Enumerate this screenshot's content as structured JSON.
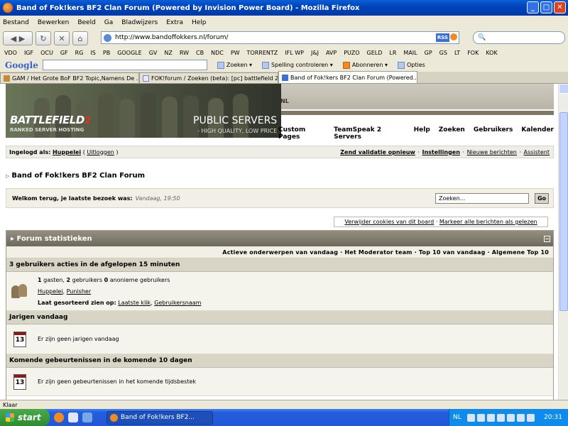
{
  "window": {
    "title": "Band of Fok!kers BF2 Clan Forum (Powered by Invision Power Board) - Mozilla Firefox",
    "min": "_",
    "max": "□",
    "close": "✕"
  },
  "menu": [
    "Bestand",
    "Bewerken",
    "Beeld",
    "Ga",
    "Bladwijzers",
    "Extra",
    "Help"
  ],
  "nav": {
    "url": "http://www.bandoffokkers.nl/forum/",
    "rss": "RSS",
    "search_placeholder": ""
  },
  "bookmarks": [
    "VDO",
    "IGF",
    "OCU",
    "GF",
    "RG",
    "IS",
    "PB",
    "GOOGLE",
    "GV",
    "NZ",
    "RW",
    "CB",
    "NDC",
    "PW",
    "TORRENTZ",
    "IFL WP",
    "J&J",
    "AVP",
    "PUZO",
    "GELD",
    "LR",
    "MAIL",
    "GP",
    "GS",
    "LT",
    "FOK",
    "KOK"
  ],
  "google_toolbar": {
    "logo": "Google",
    "search": "Zoeken",
    "spell": "Spelling controleren",
    "subscribe": "Abonneren",
    "options": "Opties"
  },
  "tabs": [
    "GAM / Het Grote BoF BF2 Topic,Namens De ...",
    "FOK!forum / Zoeken (beta): [pc] battlefield 2",
    "Band of Fok!kers BF2 Clan Forum (Powered..."
  ],
  "banner": {
    "game": "BATTLEFIELD",
    "game_num": "2",
    "ranked": "RANKED SERVER HOSTING",
    "public": "PUBLIC SERVERS",
    "quality": "- HIGH QUALITY, LOW PRICE",
    "nl": ".NL"
  },
  "topnav": [
    "Custom Pages",
    "TeamSpeak 2 Servers",
    "Help",
    "Zoeken",
    "Gebruikers",
    "Kalender"
  ],
  "userbar": {
    "prefix": "Ingelogd als:",
    "user": "Huppelei",
    "open": "(",
    "logout": "Uitloggen",
    "close": ")",
    "links": [
      "Zend validatie opnieuw",
      "Instellingen",
      "Nieuwe berichten",
      "Assistent"
    ],
    "sep": "·"
  },
  "breadcrumb": "Band of Fok!kers BF2 Clan Forum",
  "welcome": {
    "text": "Welkom terug, je laatste bezoek was:",
    "when": "Vandaag, 19:50",
    "search_value": "Zoeken...",
    "go": "Go"
  },
  "cookies": {
    "delete": "Verwijder cookies van dit board",
    "sep": "·",
    "mark": "Markeer alle berichten als gelezen"
  },
  "stats": {
    "title": "Forum statistieken",
    "collapse": "−",
    "links": "Actieve onderwerpen van vandaag · Het Moderator team · Top 10 van vandaag · Algemene Top 10",
    "active_head": "3 gebruikers acties in de afgelopen 15 minuten",
    "guests_num": "1",
    "guests_text": "gasten,",
    "users_num": "2",
    "users_text": "gebruikers",
    "anon_num": "0",
    "anon_text": "anonieme gebruikers",
    "user1": "Huppelei",
    "user_sep": ",",
    "user2": "Punisher",
    "sort_label": "Laat gesorteerd zien op:",
    "sort1": "Laatste klik",
    "sort2": "Gebruikersnaam",
    "birthdays_head": "Jarigen vandaag",
    "birthdays_text": "Er zijn geen jarigen vandaag",
    "cal_num": "13",
    "events_head": "Komende gebeurtenissen in de komende 10 dagen",
    "events_text": "Er zijn geen gebeurtenissen in het komende tijdsbestek"
  },
  "status": "Klaar",
  "taskbar": {
    "start": "start",
    "item": "Band of Fok!kers BF2...",
    "lang": "NL",
    "clock": "20:31"
  }
}
